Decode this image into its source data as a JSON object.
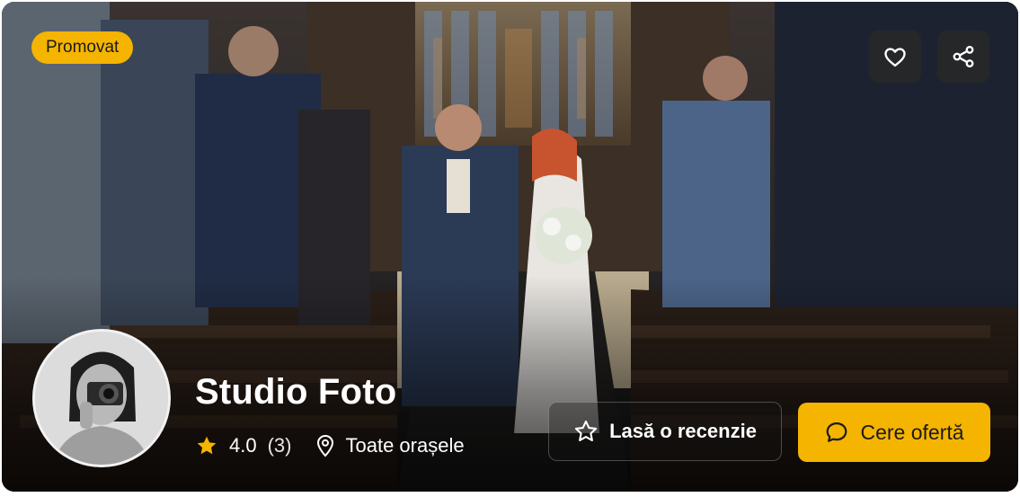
{
  "badge": {
    "label": "Promovat"
  },
  "actions": {
    "favorite_icon": "heart-icon",
    "share_icon": "share-icon"
  },
  "profile": {
    "name": "Studio Foto",
    "rating": "4.0",
    "reviews_count": "(3)",
    "location": "Toate orașele",
    "avatar_icon": "photographer-avatar"
  },
  "buttons": {
    "review_label": "Lasă o recenzie",
    "offer_label": "Cere ofertă"
  },
  "colors": {
    "accent": "#f4b400",
    "star": "#f4b400"
  }
}
